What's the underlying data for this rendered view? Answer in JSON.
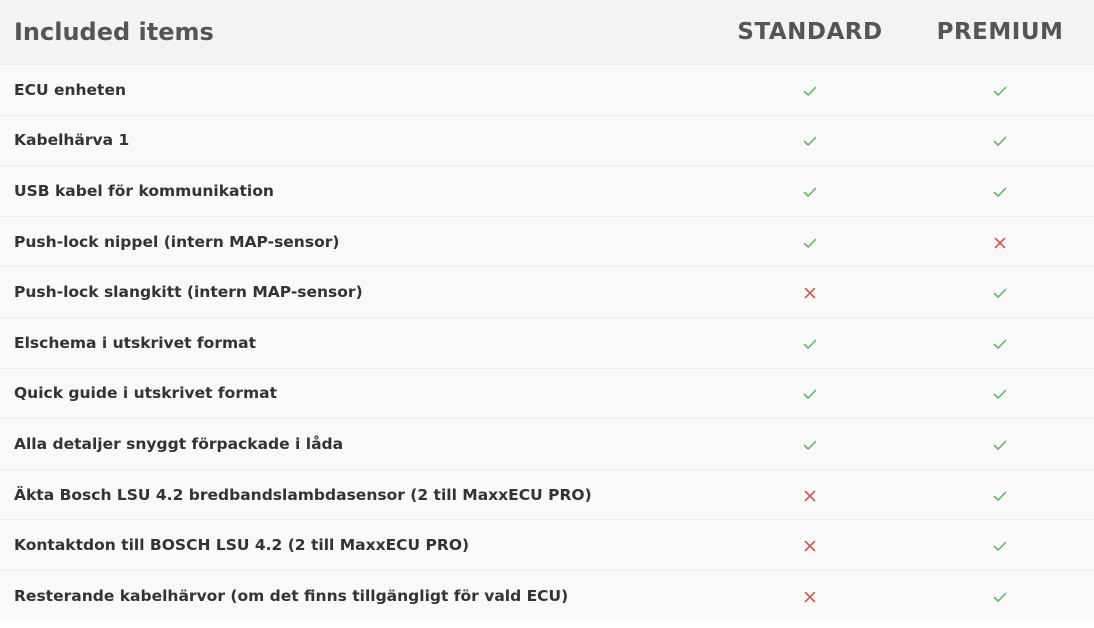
{
  "table": {
    "header": {
      "title": "Included items",
      "plans": [
        "STANDARD",
        "PREMIUM"
      ]
    },
    "colors": {
      "check": "#5cb85c",
      "cross": "#d9534f"
    },
    "rows": [
      {
        "label": "ECU enheten",
        "standard": "check",
        "premium": "check"
      },
      {
        "label": "Kabelhärva 1",
        "standard": "check",
        "premium": "check"
      },
      {
        "label": "USB kabel för kommunikation",
        "standard": "check",
        "premium": "check"
      },
      {
        "label": "Push-lock nippel (intern MAP-sensor)",
        "standard": "check",
        "premium": "cross"
      },
      {
        "label": "Push-lock slangkitt (intern MAP-sensor)",
        "standard": "cross",
        "premium": "check"
      },
      {
        "label": "Elschema i utskrivet format",
        "standard": "check",
        "premium": "check"
      },
      {
        "label": "Quick guide i utskrivet format",
        "standard": "check",
        "premium": "check"
      },
      {
        "label": "Alla detaljer snyggt förpackade i låda",
        "standard": "check",
        "premium": "check"
      },
      {
        "label": "Äkta Bosch LSU 4.2 bredbandslambdasensor (2 till MaxxECU PRO)",
        "standard": "cross",
        "premium": "check"
      },
      {
        "label": "Kontaktdon till BOSCH LSU 4.2 (2 till MaxxECU PRO)",
        "standard": "cross",
        "premium": "check"
      },
      {
        "label": "Resterande kabelhärvor (om det finns tillgängligt för vald ECU)",
        "standard": "cross",
        "premium": "check"
      }
    ]
  }
}
